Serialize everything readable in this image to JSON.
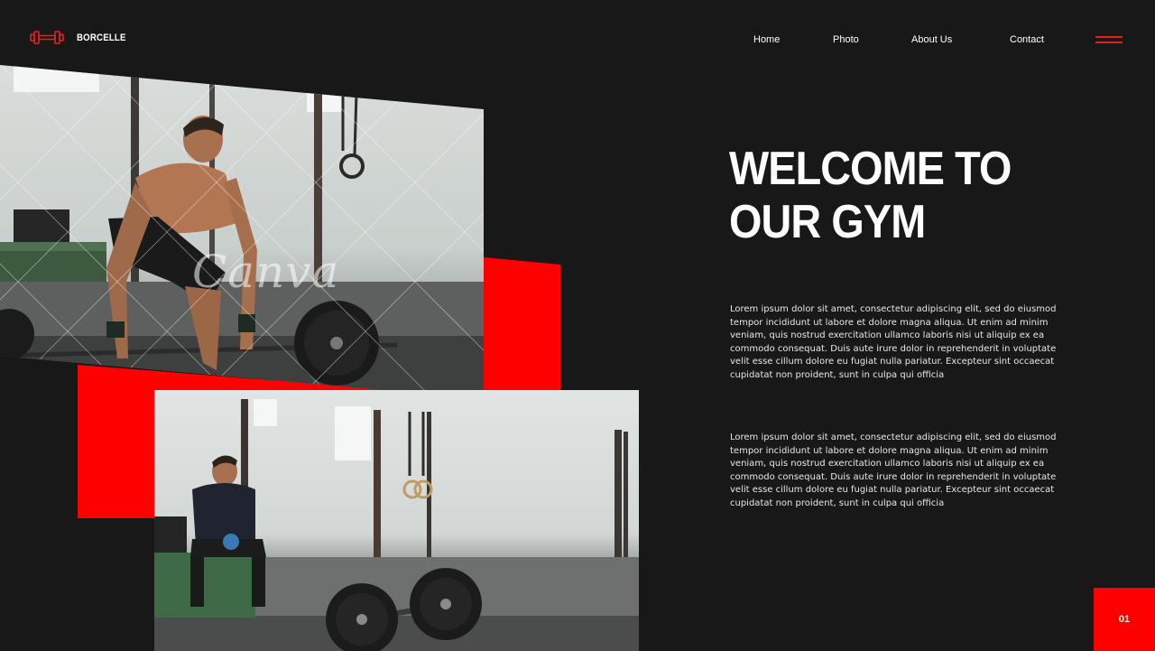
{
  "brand": {
    "name": "BORCELLE",
    "icon": "dumbbell-icon",
    "accent_color": "#e5201a"
  },
  "nav": {
    "items": [
      {
        "label": "Home"
      },
      {
        "label": "Photo"
      },
      {
        "label": "About Us"
      },
      {
        "label": "Contact"
      }
    ],
    "menu_icon": "hamburger-menu-icon"
  },
  "hero": {
    "headline_line1": "WELCOME TO",
    "headline_line2": "OUR GYM",
    "paragraph1": "Lorem ipsum dolor sit amet, consectetur adipiscing elit, sed do eiusmod tempor incididunt ut labore et dolore magna aliqua. Ut enim ad minim veniam, quis nostrud exercitation ullamco laboris nisi ut aliquip ex ea commodo consequat. Duis aute irure dolor in reprehenderit in voluptate velit esse cillum dolore eu fugiat nulla pariatur. Excepteur sint occaecat cupidatat non proident, sunt in culpa qui officia",
    "paragraph2": "Lorem ipsum dolor sit amet, consectetur adipiscing elit, sed do eiusmod tempor incididunt ut labore et dolore magna aliqua. Ut enim ad minim veniam, quis nostrud exercitation ullamco laboris nisi ut aliquip ex ea commodo consequat. Duis aute irure dolor in reprehenderit in voluptate velit esse cillum dolore eu fugiat nulla pariatur. Excepteur sint occaecat cupidatat non proident, sunt in culpa qui officia"
  },
  "photos": {
    "watermark": "Canva"
  },
  "pagination": {
    "current": "01"
  },
  "colors": {
    "background": "#181818",
    "accent_red": "#ff0000",
    "text": "#ffffff"
  }
}
